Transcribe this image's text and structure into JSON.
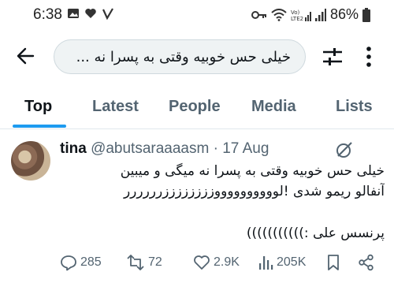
{
  "status_bar": {
    "time": "6:38",
    "battery": "86%",
    "left_icons": [
      "image-icon",
      "heart-icon",
      "check-icon"
    ],
    "right_icons": [
      "key-icon",
      "wifi-icon",
      "volte-signal-icon",
      "signal-icon",
      "battery-icon"
    ]
  },
  "search": {
    "back_icon": "arrow-left-icon",
    "query": "خیلی حس خوبیه وقتی به پسرا نه ...",
    "filter_icon": "sliders-icon",
    "more_icon": "more-vertical-icon"
  },
  "tabs": [
    {
      "label": "Top",
      "active": true
    },
    {
      "label": "Latest",
      "active": false
    },
    {
      "label": "People",
      "active": false
    },
    {
      "label": "Media",
      "active": false
    },
    {
      "label": "Lists",
      "active": false
    }
  ],
  "tweet": {
    "name": "tina",
    "handle": "@abutsaraaaasm",
    "separator": "·",
    "date": "17 Aug",
    "text_line1": "خیلی حس خوبیه وقتی به پسرا نه میگی و میبین",
    "text_line2": "آنفالو ریمو شدی !لووووووووووززززززززرررررر",
    "signature": "پرنسس علی :)))))))))))",
    "stats": {
      "replies": "285",
      "retweets": "72",
      "likes": "2.9K",
      "views": "205K"
    }
  },
  "colors": {
    "accent": "#1d9bf0",
    "text": "#0f1419",
    "muted": "#536471"
  }
}
